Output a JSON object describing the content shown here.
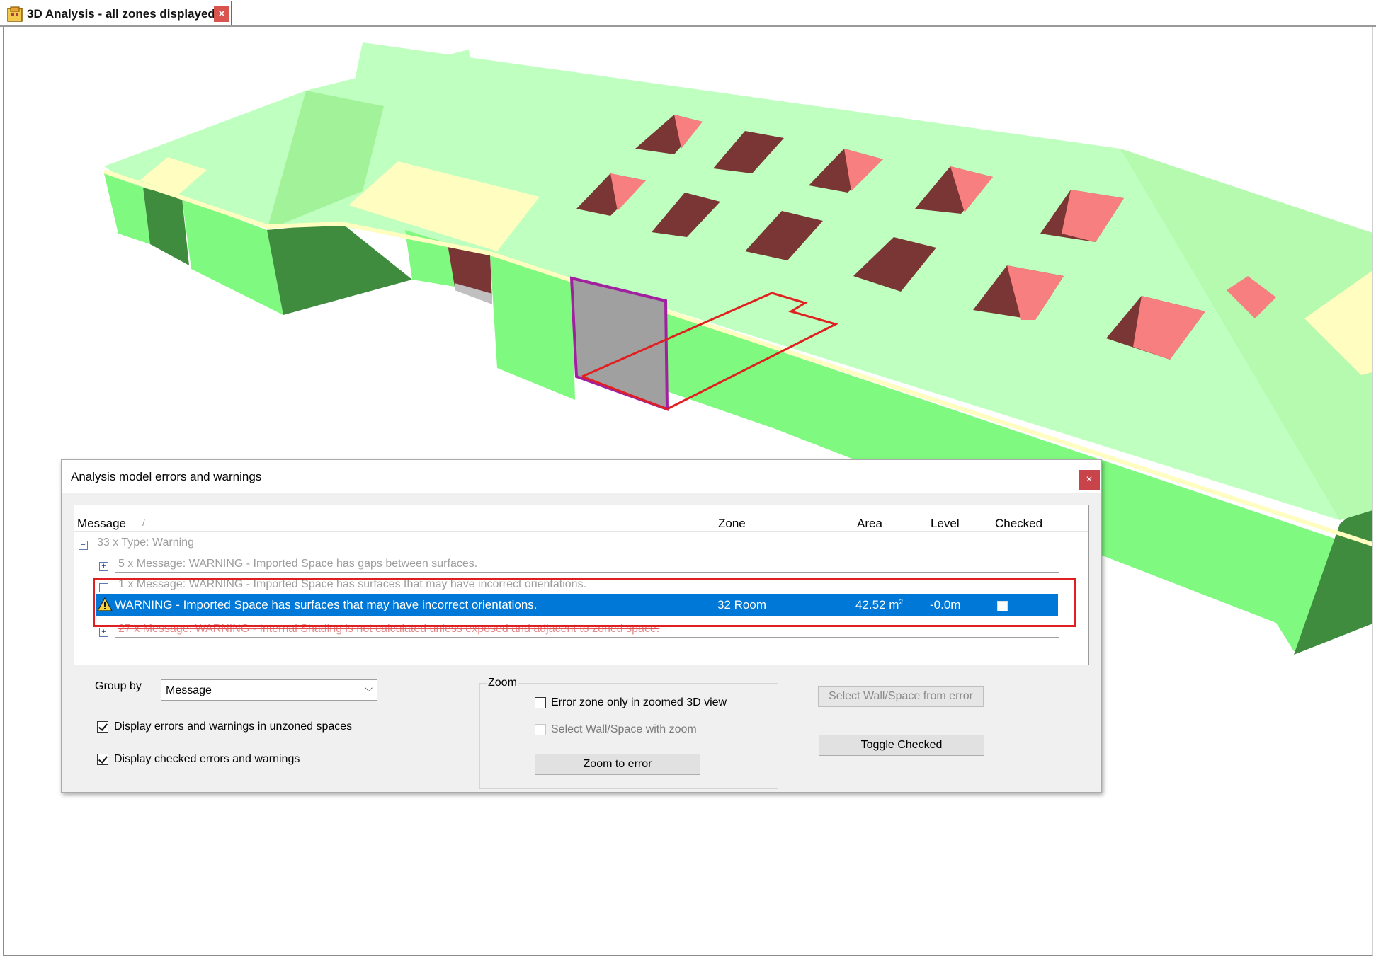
{
  "tab": {
    "title": "3D Analysis - all zones displayed",
    "close": "×"
  },
  "dialog": {
    "title": "Analysis model errors and warnings",
    "close": "×",
    "columns": {
      "message": "Message",
      "sort_indicator": "/",
      "zone": "Zone",
      "area": "Area",
      "level": "Level",
      "checked": "Checked"
    },
    "tree": {
      "group": "33 x Type: Warning",
      "group_expander": "−",
      "item1": "5 x Message: WARNING - Imported Space has gaps between surfaces.",
      "item1_expander": "+",
      "item2": "1 x Message: WARNING - Imported Space has surfaces that may have incorrect orientations.",
      "item2_expander": "−",
      "item3": "27 x Message: WARNING - Internal Shading is not calculated unless exposed and adjacent to zoned space.",
      "item3_expander": "+"
    },
    "selected_row": {
      "message": "WARNING - Imported Space has surfaces that may have incorrect orientations.",
      "zone": "32 Room",
      "area": "42.52 m",
      "area_unit_sup": "2",
      "level": "-0.0m",
      "checked": false
    },
    "group_by": {
      "label": "Group by",
      "value": "Message",
      "arrow": "⌵"
    },
    "checkboxes": {
      "unzoned": {
        "label": "Display errors and warnings in unzoned spaces",
        "checked": true
      },
      "checked_items": {
        "label": "Display checked errors and warnings",
        "checked": true
      }
    },
    "zoom": {
      "legend": "Zoom",
      "error_zone_only": {
        "label": "Error zone only in zoomed 3D view",
        "checked": false
      },
      "select_wall": {
        "label": "Select Wall/Space with zoom",
        "checked": false,
        "enabled": false
      },
      "zoom_button": "Zoom to error"
    },
    "buttons": {
      "select_wall_space": "Select Wall/Space from error",
      "toggle_checked": "Toggle Checked"
    }
  },
  "colors": {
    "roof_light": "#bfffbf",
    "wall_bright": "#80f980",
    "wall_dark": "#3e8a3e",
    "roof_slope": "#a8f5a0",
    "skylight_dark": "#7a3535",
    "skylight_light": "#f77f7f",
    "cream": "#fffdc0",
    "selection_blue": "#0078d7",
    "highlight_red": "#e02020",
    "outline_purple": "#a020a0"
  }
}
